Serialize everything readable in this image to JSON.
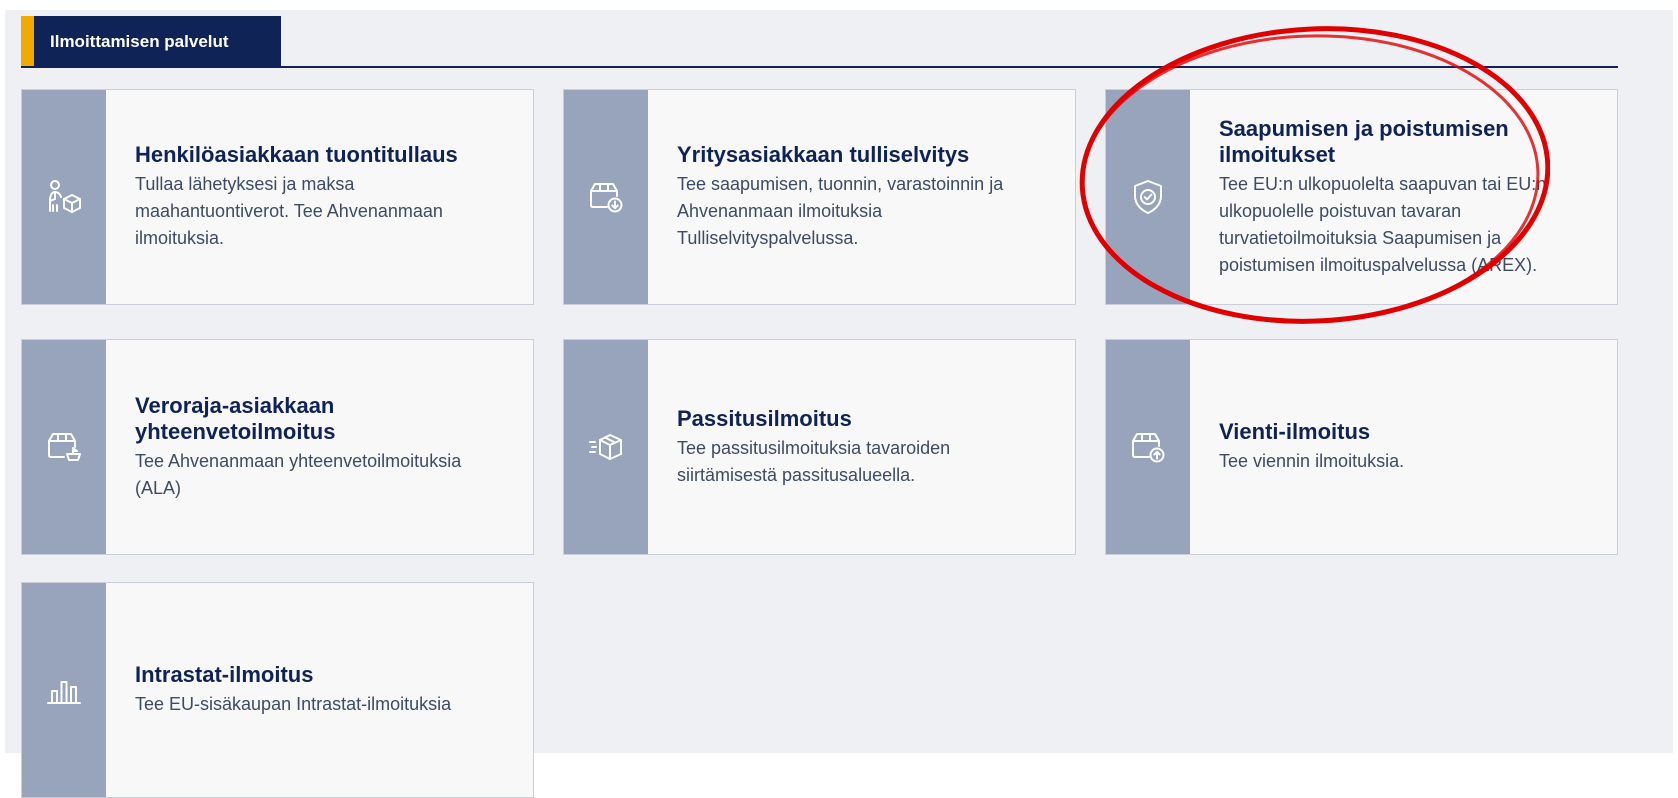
{
  "section": {
    "tab_label": "Ilmoittamisen palvelut",
    "accent_color": "#f2a900",
    "tab_color": "#0f2356"
  },
  "cards": [
    {
      "title": "Henkilöasiakkaan tuontitullaus",
      "description": "Tullaa lähetyksesi ja maksa maahantuontiverot. Tee Ahvenanmaan ilmoituksia.",
      "icon": "person-package-icon"
    },
    {
      "title": "Yritysasiakkaan tulliselvitys",
      "description": "Tee saapumisen, tuonnin, varastoinnin ja Ahvenanmaan ilmoituksia Tulliselvityspalvelussa.",
      "icon": "package-download-icon"
    },
    {
      "title": "Saapumisen ja poistumisen ilmoitukset",
      "description": "Tee EU:n ulkopuolelta saapuvan tai EU:n ulkopuolelle poistuvan tavaran turvatietoilmoituksia Saapumisen ja poistumisen ilmoituspalvelussa (AREX).",
      "icon": "shield-check-icon"
    },
    {
      "title": "Veroraja-asiakkaan yhteenvetoilmoitus",
      "description": "Tee Ahvenanmaan yhteenvetoilmoituksia (ALA)",
      "icon": "package-ship-icon"
    },
    {
      "title": "Passitusilmoitus",
      "description": "Tee passitusilmoituksia tavaroiden siirtämisestä passitusalueella.",
      "icon": "moving-package-icon"
    },
    {
      "title": "Vienti-ilmoitus",
      "description": "Tee viennin ilmoituksia.",
      "icon": "package-upload-icon"
    },
    {
      "title": "Intrastat-ilmoitus",
      "description": "Tee EU-sisäkaupan Intrastat-ilmoituksia",
      "icon": "bar-chart-icon"
    }
  ],
  "colors": {
    "rail": "#98a4bc",
    "title": "#0f2356",
    "text": "#3d4b63",
    "annotation": "#e10000"
  }
}
